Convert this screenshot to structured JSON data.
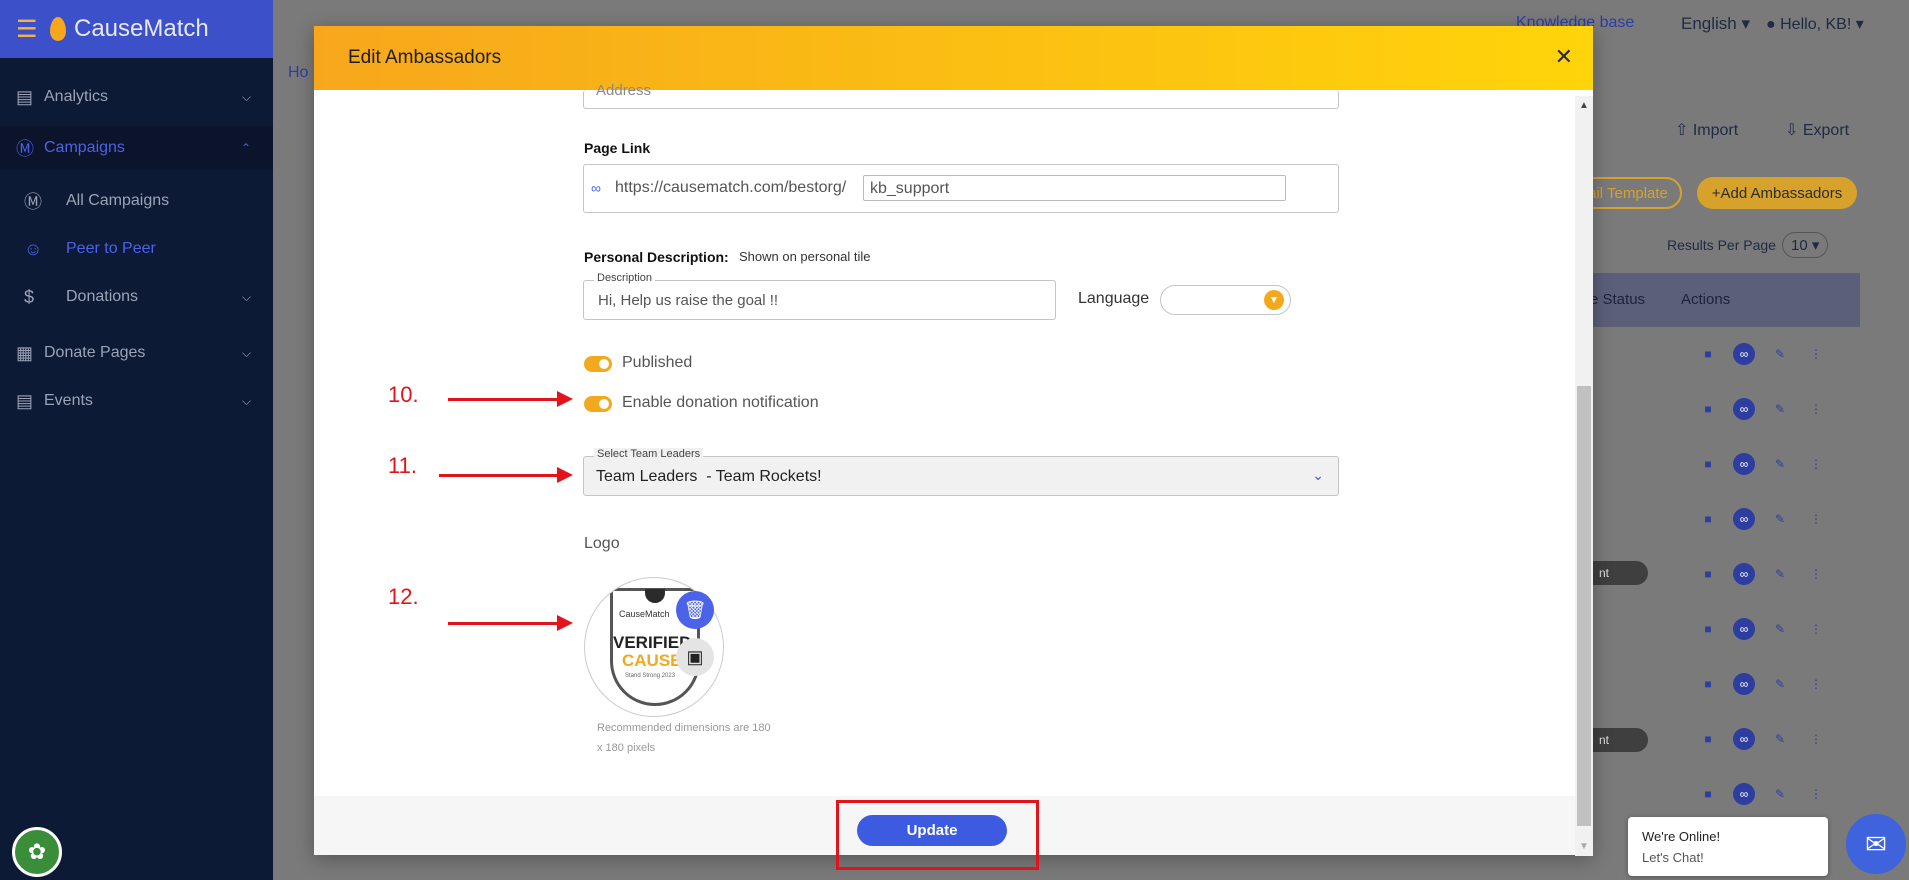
{
  "app": {
    "name": "CauseMatch"
  },
  "sidebar": {
    "items": [
      {
        "label": "Analytics",
        "icon": "bar-chart-icon"
      },
      {
        "label": "Campaigns",
        "icon": "dollar-circle-icon"
      },
      {
        "label": "All Campaigns",
        "icon": "dollar-circle-icon"
      },
      {
        "label": "Peer to Peer",
        "icon": "people-icon"
      },
      {
        "label": "Donations",
        "icon": "dollar-icon"
      },
      {
        "label": "Donate Pages",
        "icon": "grid-icon"
      },
      {
        "label": "Events",
        "icon": "calendar-icon"
      }
    ]
  },
  "topbar": {
    "knowledge_base": "Knowledge base",
    "language": "English",
    "greeting": "Hello, KB!"
  },
  "background": {
    "breadcrumb_fragment": "Ho",
    "import": "Import",
    "export": "Export",
    "email_template": "ail Template",
    "add_ambassadors": "Add Ambassadors",
    "results_per_page_label": "Results Per Page",
    "results_per_page_value": "10",
    "col_status": "e Status",
    "col_actions": "Actions",
    "status_fragment": "nt"
  },
  "modal": {
    "title": "Edit Ambassadors",
    "address_placeholder": "Address",
    "page_link_label": "Page Link",
    "page_link_prefix": "https://causematch.com/bestorg/",
    "page_link_value": "kb_support",
    "personal_description_label": "Personal Description:",
    "personal_description_note": "Shown on personal tile",
    "description_label": "Description",
    "description_value": "Hi, Help us raise the goal !!",
    "language_label": "Language",
    "published_label": "Published",
    "donation_notification_label": "Enable donation notification",
    "team_leaders_label": "Select Team Leaders",
    "team_leaders_value": "Team Leaders  - Team Rockets!",
    "logo_label": "Logo",
    "logo_text_brand": "CauseMatch",
    "logo_text_verified": "VERIFIED",
    "logo_text_cause": "CAUSE",
    "logo_text_year": "Stand Strong 2023",
    "logo_hint_line1": "Recommended dimensions are 180",
    "logo_hint_line2": "x 180 pixels",
    "update_button": "Update"
  },
  "annotations": {
    "a10": "10.",
    "a11": "11.",
    "a12": "12."
  },
  "chat": {
    "line1": "We're Online!",
    "line2": "Let's Chat!"
  },
  "colors": {
    "accent": "#f7a71c",
    "primary": "#3d5be0",
    "sidebar": "#0d1a36",
    "annotation": "#e0141a"
  }
}
